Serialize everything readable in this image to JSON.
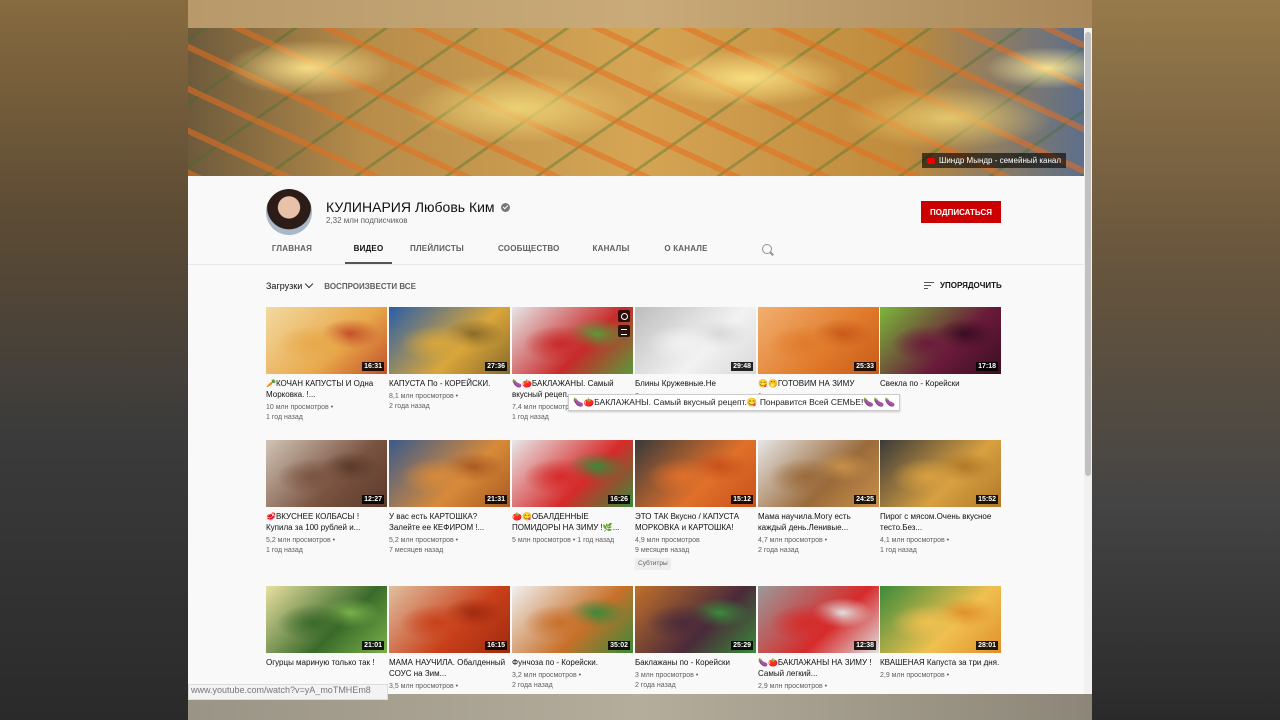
{
  "channel": {
    "banner_label": "Шиндр Мындр - семейный канал",
    "name": "КУЛИНАРИЯ Любовь Ким",
    "subscribers": "2,32 млн подписчиков",
    "subscribe_label": "ПОДПИСАТЬСЯ"
  },
  "tabs": [
    {
      "label": "ГЛАВНАЯ"
    },
    {
      "label": "ВИДЕО"
    },
    {
      "label": "ПЛЕЙЛИСТЫ"
    },
    {
      "label": "СООБЩЕСТВО"
    },
    {
      "label": "КАНАЛЫ"
    },
    {
      "label": "О КАНАЛЕ"
    }
  ],
  "filter": {
    "uploads_label": "Загрузки",
    "play_all_label": "ВОСПРОИЗВЕСТИ ВСЕ",
    "sort_label": "УПОРЯДОЧИТЬ"
  },
  "tooltip": "🍆🍅БАКЛАЖАНЫ. Самый вкусный рецепт.😋 Понравится Всей СЕМЬЕ!🍆🍆🍆",
  "status_url": "www.youtube.com/watch?v=yA_moTMHEm8",
  "videos": [
    {
      "title": "🥕КОЧАН КАПУСТЫ И Одна Морковка. !...",
      "duration": "16:31",
      "views": "10 млн просмотров •",
      "date": "1 год назад",
      "colors": [
        "#e8a84a",
        "#c4502a",
        "#f3d9a0"
      ]
    },
    {
      "title": "КАПУСТА По - КОРЕЙСКИ.",
      "duration": "27:36",
      "views": "8,1 млн просмотров •",
      "date": "2 года назад",
      "colors": [
        "#d9a63a",
        "#8a6a2a",
        "#2a5ea8"
      ]
    },
    {
      "title": "🍆🍅БАКЛАЖАНЫ. Самый вкусный рецеп...",
      "duration": "",
      "views": "7,4 млн просмотров •",
      "date": "1 год назад",
      "colors": [
        "#c82a2a",
        "#5a9a3a",
        "#e6e6e6"
      ]
    },
    {
      "title": "Блины Кружевные.Не",
      "duration": "29:48",
      "views": "",
      "date": "2 года назад",
      "colors": [
        "#f2f2f2",
        "#d8d8d8",
        "#bdbdbd"
      ]
    },
    {
      "title": "😋🤭ГОТОВИМ НА ЗИМУ",
      "duration": "25:33",
      "views": "",
      "date": "1 год назад",
      "colors": [
        "#e07a2a",
        "#c85a1a",
        "#f1b070"
      ]
    },
    {
      "title": "Свекла по - Корейски",
      "duration": "17:18",
      "views": "",
      "date": "",
      "colors": [
        "#6a1a3a",
        "#3a0e22",
        "#7ab83a"
      ]
    },
    {
      "title": "🥩ВКУСНЕЕ КОЛБАСЫ ! Купила за 100 рублей и...",
      "duration": "12:27",
      "views": "5,2 млн просмотров •",
      "date": "1 год назад",
      "colors": [
        "#7a5240",
        "#5a3a2a",
        "#d0c4b6"
      ]
    },
    {
      "title": "У вас есть КАРТОШКА? Залейте ее КЕФИРОМ !...",
      "duration": "21:31",
      "views": "5,2 млн просмотров •",
      "date": "7 месяцев назад",
      "colors": [
        "#d88a3a",
        "#a85a20",
        "#3a5a8a"
      ]
    },
    {
      "title": "🍅😋ОБАЛДЕННЫЕ ПОМИДОРЫ НА ЗИМУ !🌿...",
      "duration": "16:26",
      "views": "5 млн просмотров • 1 год назад",
      "date": "",
      "colors": [
        "#d62a2a",
        "#3a8a3a",
        "#e8e8e8"
      ]
    },
    {
      "title": "ЭТО ТАК Вкусно / КАПУСТА МОРКОВКА и КАРТОШКА!",
      "duration": "15:12",
      "views": "4,9 млн просмотров",
      "date": "9 месяцев назад",
      "badge": "Субтитры",
      "colors": [
        "#e0702a",
        "#c8501a",
        "#3a3a3a"
      ]
    },
    {
      "title": "Мама научила.Могу есть каждый день.Ленивые...",
      "duration": "24:25",
      "views": "4,7 млн просмотров •",
      "date": "2 года назад",
      "colors": [
        "#9a6a3a",
        "#c8904a",
        "#e6e6e6"
      ]
    },
    {
      "title": "Пирог с мясом.Очень вкусное тесто.Без...",
      "duration": "15:52",
      "views": "4,1 млн просмотров •",
      "date": "1 год назад",
      "colors": [
        "#d8a040",
        "#b07828",
        "#3a3a3a"
      ]
    },
    {
      "title": "Огурцы мариную только так !",
      "duration": "21:01",
      "views": "",
      "date": "",
      "colors": [
        "#3a6a2a",
        "#7ab04a",
        "#e8e0a0"
      ]
    },
    {
      "title": "МАМА НАУЧИЛА. Обалденный СОУС на Зим...",
      "duration": "16:15",
      "views": "3,5 млн просмотров •",
      "date": "",
      "colors": [
        "#c8401a",
        "#a02a10",
        "#e0c0a0"
      ]
    },
    {
      "title": "Фунчоза по - Корейски.",
      "duration": "35:02",
      "views": "3,2 млн просмотров •",
      "date": "2 года назад",
      "colors": [
        "#c8702a",
        "#3a8a3a",
        "#f0f0f0"
      ]
    },
    {
      "title": "Баклажаны по - Корейски",
      "duration": "25:29",
      "views": "3 млн просмотров •",
      "date": "2 года назад",
      "colors": [
        "#4a2a3a",
        "#3a8a3a",
        "#c0702a"
      ]
    },
    {
      "title": "🍆🍅БАКЛАЖАНЫ НА ЗИМУ ! Самый легкий...",
      "duration": "12:38",
      "views": "2,9 млн просмотров •",
      "date": "",
      "colors": [
        "#d62a2a",
        "#e0e0e0",
        "#9a9a9a"
      ]
    },
    {
      "title": "КВАШЕНАЯ Капуста за три дня.",
      "duration": "28:01",
      "views": "2,9 млн просмотров •",
      "date": "",
      "colors": [
        "#f0c050",
        "#e0902a",
        "#3a8a3a"
      ]
    }
  ]
}
